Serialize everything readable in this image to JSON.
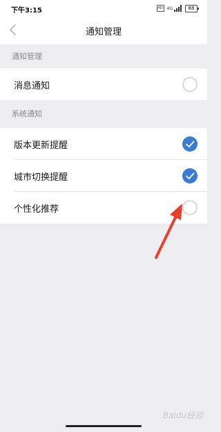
{
  "status_bar": {
    "time": "下午3:15",
    "network": "4G",
    "battery": "88"
  },
  "nav": {
    "title": "通知管理"
  },
  "sections": [
    {
      "header": "通知管理",
      "items": [
        {
          "label": "消息通知",
          "checked": false
        }
      ]
    },
    {
      "header": "系统通知",
      "items": [
        {
          "label": "版本更新提醒",
          "checked": true
        },
        {
          "label": "城市切换提醒",
          "checked": true
        },
        {
          "label": "个性化推荐",
          "checked": false
        }
      ]
    }
  ],
  "watermark": "Baidu经验",
  "colors": {
    "accent": "#3a7bd5",
    "annotation_arrow": "#e8402a",
    "page_background": "#eeeef0"
  }
}
